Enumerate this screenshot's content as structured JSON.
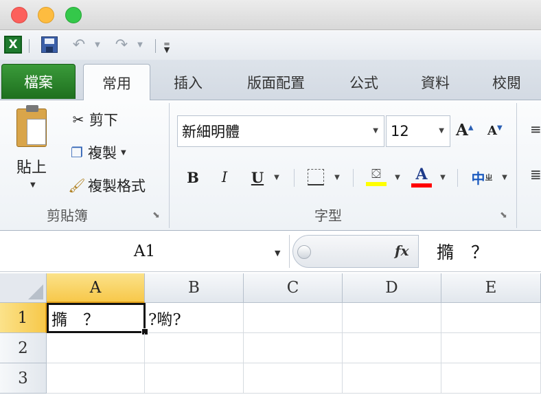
{
  "window": {
    "controls": [
      "close",
      "minimize",
      "zoom"
    ]
  },
  "qat": {
    "app_icon": "excel-icon",
    "app_icon_letter": "X",
    "save_icon": "save-icon",
    "undo_icon": "undo-icon",
    "redo_icon": "redo-icon",
    "customize_icon": "customize-qat-icon"
  },
  "tabs": [
    {
      "label": "檔案",
      "kind": "file"
    },
    {
      "label": "常用",
      "kind": "active"
    },
    {
      "label": "插入"
    },
    {
      "label": "版面配置"
    },
    {
      "label": "公式"
    },
    {
      "label": "資料"
    },
    {
      "label": "校閱"
    }
  ],
  "ribbon": {
    "clipboard": {
      "paste_label": "貼上",
      "cut_label": "剪下",
      "copy_label": "複製",
      "format_painter_label": "複製格式",
      "group_label": "剪貼簿"
    },
    "font": {
      "font_name": "新細明體",
      "font_size": "12",
      "bold": "B",
      "italic": "I",
      "underline": "U",
      "font_color_letter": "A",
      "grow_letter": "A",
      "shrink_letter": "A",
      "phonetic_label": "中",
      "group_label": "字型",
      "fill_color": "#ffff00",
      "font_color": "#ff0000"
    }
  },
  "formula_bar": {
    "name_box": "A1",
    "fx_label": "fx",
    "content": "撱　？"
  },
  "grid": {
    "columns": [
      "A",
      "B",
      "C",
      "D",
      "E"
    ],
    "rows": [
      "1",
      "2",
      "3"
    ],
    "selected_cell": "A1",
    "cells": {
      "A1": "撱　？",
      "B1": "?喲?"
    }
  }
}
